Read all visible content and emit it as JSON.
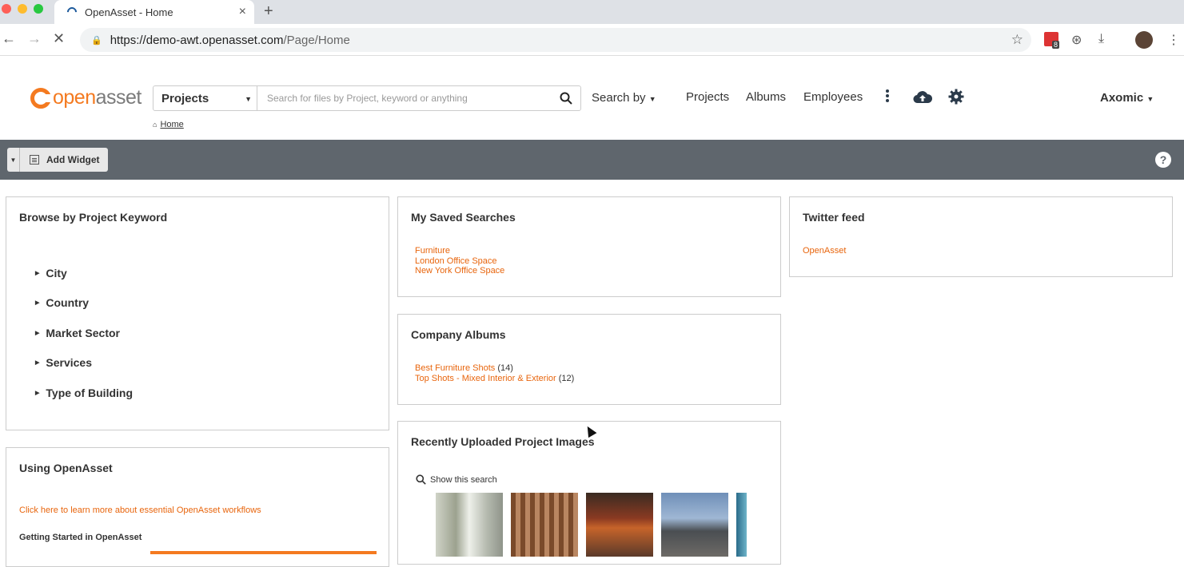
{
  "browser": {
    "tab_title": "OpenAsset - Home",
    "tab_close": "×",
    "new_tab": "+",
    "url_host": "https://demo-awt.openasset.com",
    "url_path": "/Page/Home",
    "ext_badge": "8"
  },
  "header": {
    "logo_open": "open",
    "logo_asset": "asset",
    "search_scope": "Projects",
    "search_placeholder": "Search for files by Project, keyword or anything",
    "search_by": "Search by",
    "nav": [
      "Projects",
      "Albums",
      "Employees"
    ],
    "user": "Axomic",
    "breadcrumb_home": "Home"
  },
  "toolbar": {
    "add_widget": "Add Widget",
    "help": "?"
  },
  "widgets": {
    "browse": {
      "title": "Browse by Project Keyword",
      "items": [
        "City",
        "Country",
        "Market Sector",
        "Services",
        "Type of Building"
      ]
    },
    "saved_searches": {
      "title": "My Saved Searches",
      "items": [
        "Furniture",
        "London Office Space",
        "New York Office Space"
      ]
    },
    "twitter": {
      "title": "Twitter feed",
      "link": "OpenAsset"
    },
    "albums": {
      "title": "Company Albums",
      "items": [
        {
          "name": "Best Furniture Shots",
          "count": "(14)"
        },
        {
          "name": "Top Shots - Mixed Interior & Exterior",
          "count": "(12)"
        }
      ]
    },
    "using": {
      "title": "Using OpenAsset",
      "link": "Click here to learn more about essential OpenAsset workflows",
      "subheading": "Getting Started in OpenAsset"
    },
    "recent": {
      "title": "Recently Uploaded Project Images",
      "show_search": "Show this search"
    }
  },
  "colors": {
    "accent": "#e8650d",
    "toolbar_bg": "#5f666d",
    "logo_orange": "#f47a20"
  }
}
